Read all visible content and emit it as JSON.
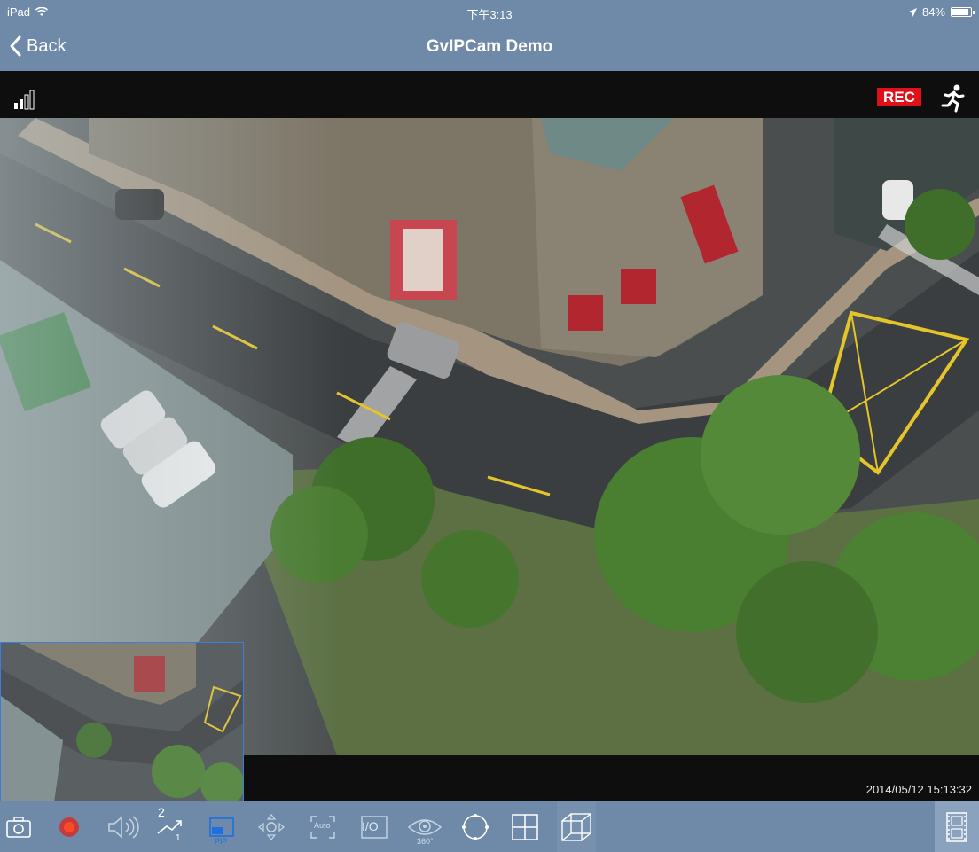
{
  "status_bar": {
    "device": "iPad",
    "time": "下午3:13",
    "battery": "84%"
  },
  "nav": {
    "back_label": "Back",
    "title": "GvIPCam Demo"
  },
  "video": {
    "rec_label": "REC",
    "timestamp": "2014/05/12 15:13:32",
    "pip_label": "PIP"
  },
  "toolbar": {
    "stream_top": "2",
    "stream_bottom": "1",
    "pip": "PIP",
    "auto": "Auto",
    "io": "I/O",
    "view_360": "360°"
  },
  "colors": {
    "bar": "#6f8aa8",
    "rec": "#e0101a",
    "pip_border": "#3a7ee0",
    "pip_active": "#1f6fe0"
  }
}
